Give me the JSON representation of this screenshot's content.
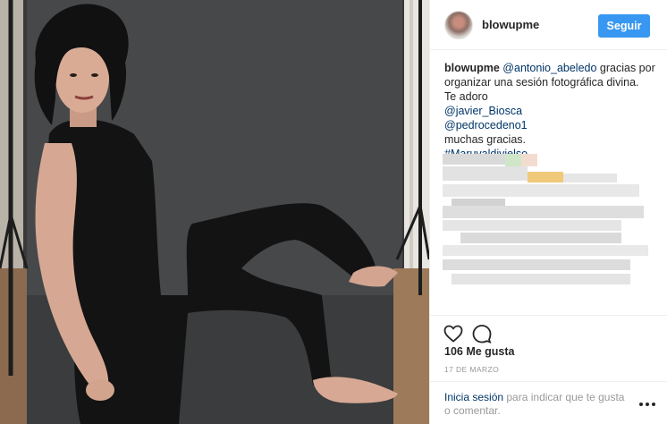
{
  "post": {
    "username": "blowupme",
    "follow_label": "Seguir",
    "avatar_icon": "avatar-feet-photo",
    "photo_description_icon": "photo-woman-seated"
  },
  "caption": {
    "username": "blowupme",
    "mention_1": "@antonio_abeledo",
    "text_1": " gracias por organizar una sesión fotográfica divina.",
    "text_2": "Te adoro",
    "mention_2": "@javier_Biosca",
    "mention_3": "@pedrocedeno1",
    "text_3": "muchas gracias.",
    "hashtag": "#Maruvaldivielso"
  },
  "actions": {
    "like_icon": "heart-icon",
    "comment_icon": "comment-icon",
    "likes_label": "106 Me gusta",
    "date": "17 DE MARZO"
  },
  "footer": {
    "login_link": "Inicia sesión",
    "login_text": " para indicar que te gusta o comentar.",
    "more_icon": "more-options-icon"
  },
  "colors": {
    "follow_button": "#3897f0",
    "link": "#003569",
    "muted": "#999999",
    "divider": "#efefef"
  }
}
